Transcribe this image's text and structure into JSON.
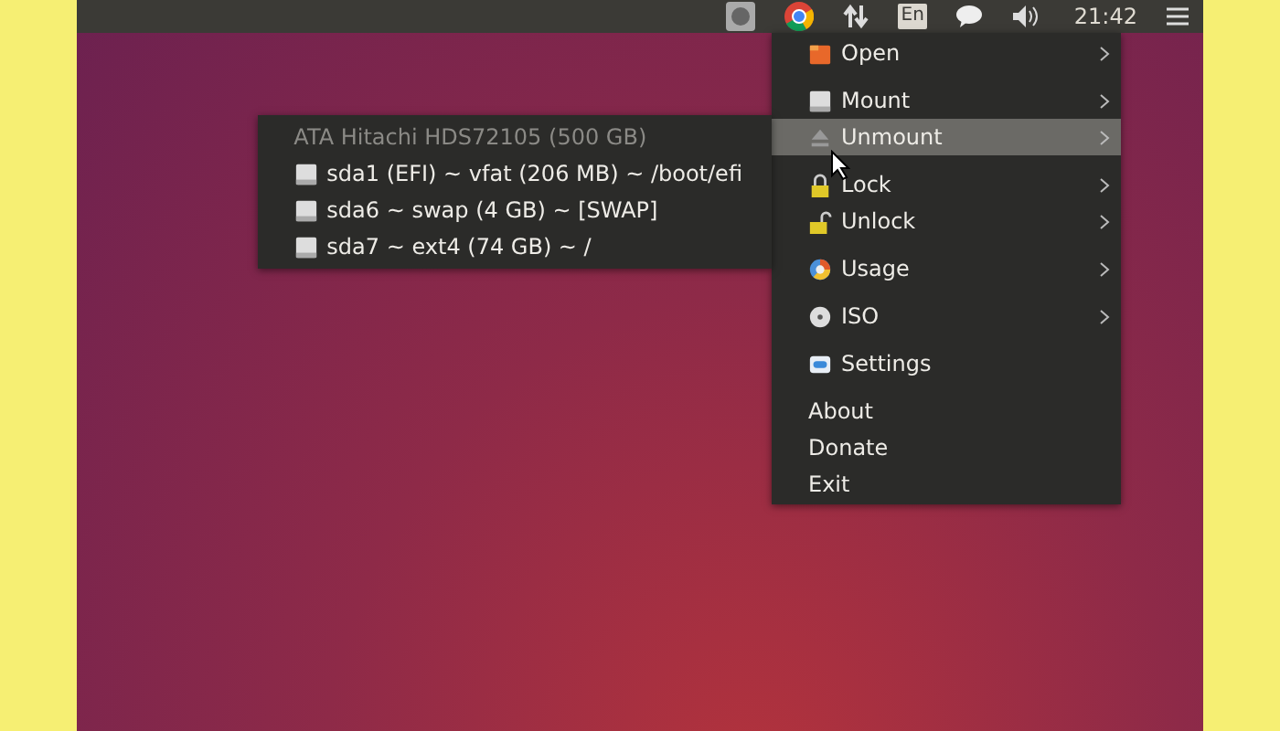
{
  "top_bar": {
    "indicators": [
      {
        "kind": "app"
      },
      {
        "kind": "browser"
      },
      {
        "kind": "network"
      },
      {
        "kind": "keyboard",
        "label": "En"
      },
      {
        "kind": "messages"
      },
      {
        "kind": "sound"
      },
      {
        "kind": "clock",
        "label": "21:42"
      },
      {
        "kind": "menu"
      }
    ]
  },
  "menu": {
    "sections": [
      [
        {
          "label": "Open",
          "kind": "folder",
          "submenu": true,
          "selected": false
        }
      ],
      [
        {
          "label": "Mount",
          "kind": "drive",
          "submenu": true,
          "selected": false
        },
        {
          "label": "Unmount",
          "kind": "eject",
          "submenu": true,
          "selected": true
        }
      ],
      [
        {
          "label": "Lock",
          "kind": "lock",
          "submenu": true,
          "selected": false
        },
        {
          "label": "Unlock",
          "kind": "unlock",
          "submenu": true,
          "selected": false
        }
      ],
      [
        {
          "label": "Usage",
          "kind": "usage",
          "submenu": true,
          "selected": false
        }
      ],
      [
        {
          "label": "ISO",
          "kind": "disc",
          "submenu": true,
          "selected": false
        }
      ],
      [
        {
          "label": "Settings",
          "kind": "settings",
          "submenu": false,
          "selected": false
        }
      ],
      [
        {
          "label": "About",
          "kind": "plain",
          "submenu": false,
          "selected": false
        },
        {
          "label": "Donate",
          "kind": "plain",
          "submenu": false,
          "selected": false
        },
        {
          "label": "Exit",
          "kind": "plain",
          "submenu": false,
          "selected": false
        }
      ]
    ]
  },
  "submenu": {
    "header": "ATA Hitachi HDS72105 (500 GB)",
    "items": [
      {
        "label": "sda1 (EFI) ~ vfat (206 MB) ~ /boot/efi"
      },
      {
        "label": "sda6 ~ swap (4 GB) ~ [SWAP]"
      },
      {
        "label": "sda7 ~ ext4 (74 GB) ~ /"
      }
    ]
  }
}
